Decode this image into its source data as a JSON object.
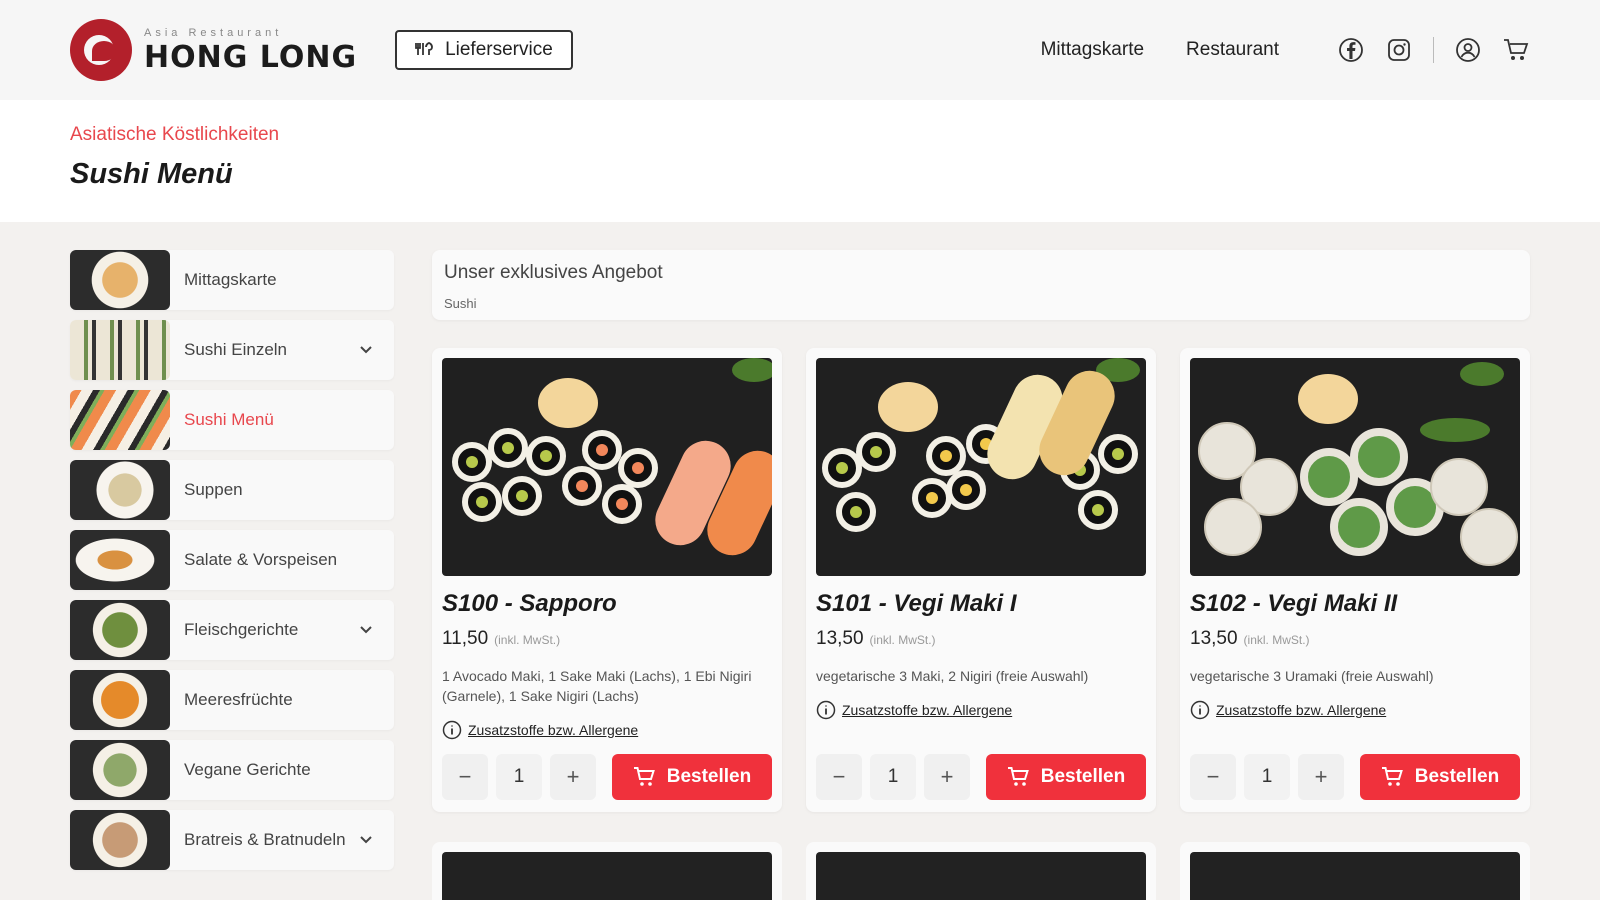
{
  "header": {
    "logo_sub": "Asia Restaurant",
    "logo_main": "HONG LONG",
    "delivery_label": "Lieferservice",
    "nav": [
      "Mittagskarte",
      "Restaurant"
    ],
    "icons": [
      "facebook-icon",
      "instagram-icon",
      "user-icon",
      "cart-icon"
    ]
  },
  "page": {
    "subtitle": "Asiatische Köstlichkeiten",
    "title": "Sushi Menü"
  },
  "sidebar": {
    "items": [
      {
        "label": "Mittagskarte",
        "expandable": false,
        "active": false
      },
      {
        "label": "Sushi Einzeln",
        "expandable": true,
        "active": false
      },
      {
        "label": "Sushi Menü",
        "expandable": false,
        "active": true
      },
      {
        "label": "Suppen",
        "expandable": false,
        "active": false
      },
      {
        "label": "Salate & Vorspeisen",
        "expandable": false,
        "active": false
      },
      {
        "label": "Fleischgerichte",
        "expandable": true,
        "active": false
      },
      {
        "label": "Meeresfrüchte",
        "expandable": false,
        "active": false
      },
      {
        "label": "Vegane Gerichte",
        "expandable": false,
        "active": false
      },
      {
        "label": "Bratreis & Bratnudeln",
        "expandable": true,
        "active": false
      }
    ]
  },
  "offer": {
    "title": "Unser exklusives Angebot",
    "category": "Sushi"
  },
  "products": [
    {
      "name": "S100 - Sapporo",
      "price": "11,50",
      "vat": "(inkl. MwSt.)",
      "description": "1 Avocado Maki, 1 Sake Maki (Lachs), 1 Ebi Nigiri (Garnele), 1 Sake Nigiri (Lachs)",
      "allergen_link": "Zusatzstoffe bzw. Allergene",
      "quantity": "1",
      "order_label": "Bestellen"
    },
    {
      "name": "S101 - Vegi Maki I",
      "price": "13,50",
      "vat": "(inkl. MwSt.)",
      "description": "vegetarische 3 Maki, 2 Nigiri (freie Auswahl)",
      "allergen_link": "Zusatzstoffe bzw. Allergene",
      "quantity": "1",
      "order_label": "Bestellen"
    },
    {
      "name": "S102 - Vegi Maki II",
      "price": "13,50",
      "vat": "(inkl. MwSt.)",
      "description": "vegetarische 3 Uramaki (freie Auswahl)",
      "allergen_link": "Zusatzstoffe bzw. Allergene",
      "quantity": "1",
      "order_label": "Bestellen"
    }
  ],
  "controls": {
    "minus": "−",
    "plus": "+"
  },
  "colors": {
    "accent": "#f0313c",
    "subtitle": "#e8474d",
    "brand": "#b3202b"
  }
}
